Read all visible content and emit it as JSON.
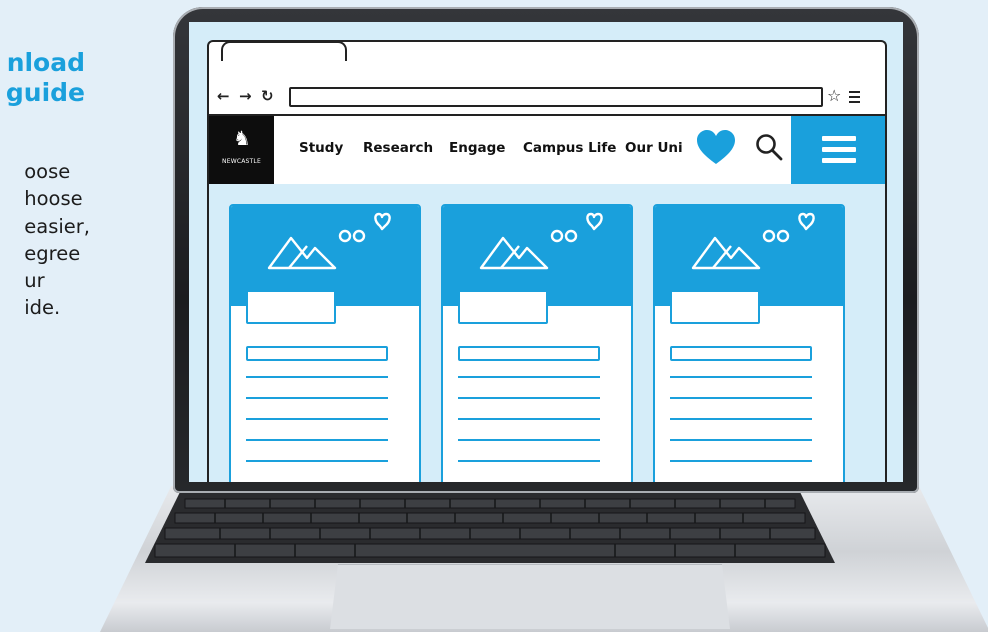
{
  "promo": {
    "heading_line1": "nload",
    "heading_line2": "guide",
    "body_lines": [
      "oose",
      "hoose",
      "easier,",
      "egree",
      "ur",
      "ide."
    ]
  },
  "browser": {
    "back_icon": "arrow-left-icon",
    "forward_icon": "arrow-right-icon",
    "reload_icon": "reload-icon",
    "url_value": "",
    "bookmark_icon": "star-icon",
    "menu_icon": "menu-icon"
  },
  "site": {
    "logo_text": "NEWCASTLE",
    "nav": [
      "Study",
      "Research",
      "Engage",
      "Campus Life",
      "Our Uni"
    ],
    "favorites_icon": "heart-icon",
    "search_icon": "search-icon",
    "menu_icon": "hamburger-icon"
  },
  "cards": [
    {
      "image_icon": "mountains-icon"
    },
    {
      "image_icon": "mountains-icon"
    },
    {
      "image_icon": "mountains-icon"
    }
  ],
  "colors": {
    "accent": "#1aa0dc",
    "screen_bg": "#d5edf9",
    "page_bg": "#e3eff8"
  }
}
